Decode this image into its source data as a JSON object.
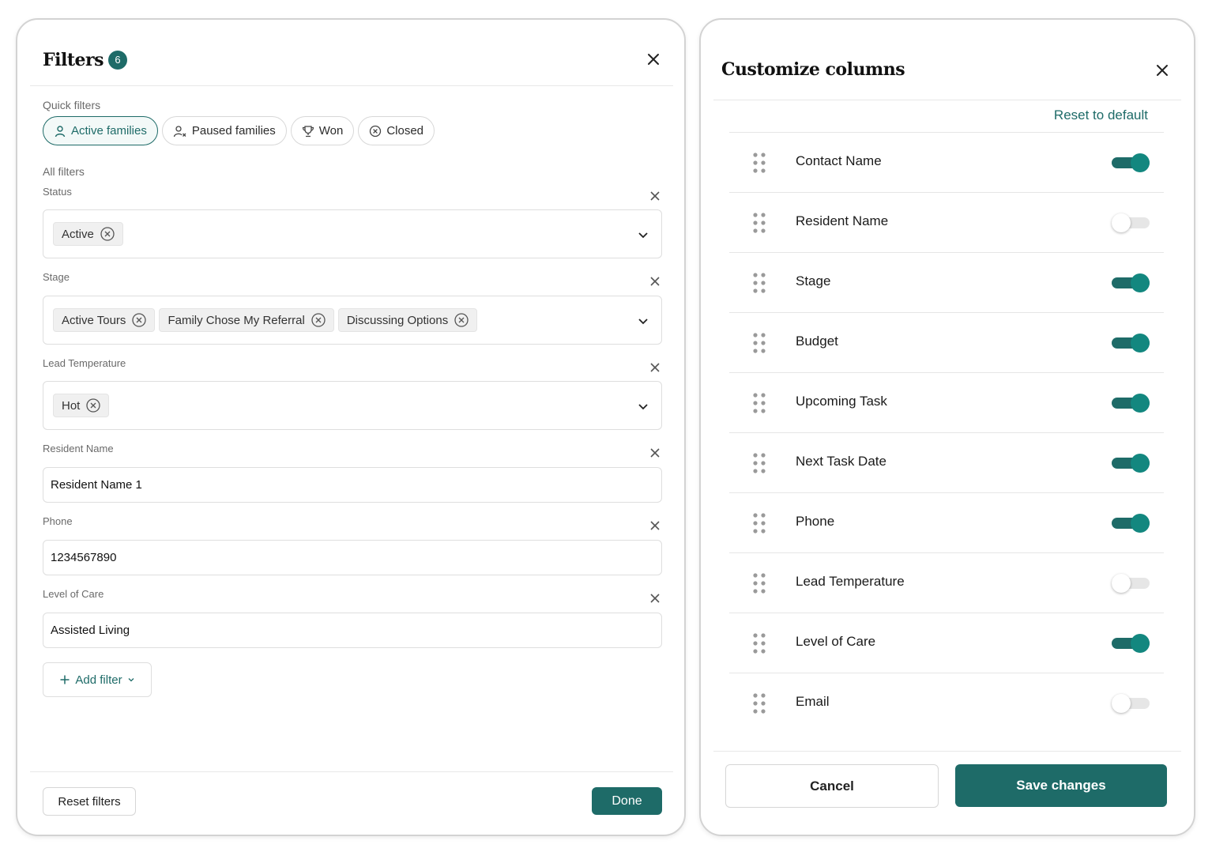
{
  "filters_panel": {
    "title": "Filters",
    "count": "6",
    "quick_filters_label": "Quick filters",
    "quick_filters": [
      {
        "label": "Active families",
        "icon": "user-icon",
        "active": true
      },
      {
        "label": "Paused families",
        "icon": "user-x-icon",
        "active": false
      },
      {
        "label": "Won",
        "icon": "trophy-icon",
        "active": false
      },
      {
        "label": "Closed",
        "icon": "circle-x-icon",
        "active": false
      }
    ],
    "all_filters_label": "All filters",
    "status": {
      "label": "Status",
      "tags": [
        "Active"
      ]
    },
    "stage": {
      "label": "Stage",
      "tags": [
        "Active Tours",
        "Family Chose My Referral",
        "Discussing Options"
      ]
    },
    "lead_temperature": {
      "label": "Lead Temperature",
      "tags": [
        "Hot"
      ]
    },
    "resident_name": {
      "label": "Resident Name",
      "value": "Resident Name 1"
    },
    "phone": {
      "label": "Phone",
      "value": "1234567890"
    },
    "level_of_care": {
      "label": "Level of Care",
      "value": "Assisted Living"
    },
    "add_filter_label": "Add filter",
    "reset_label": "Reset filters",
    "done_label": "Done"
  },
  "columns_panel": {
    "title": "Customize columns",
    "reset_default_label": "Reset to default",
    "columns": [
      {
        "name": "Contact Name",
        "enabled": true
      },
      {
        "name": "Resident Name",
        "enabled": false
      },
      {
        "name": "Stage",
        "enabled": true
      },
      {
        "name": "Budget",
        "enabled": true
      },
      {
        "name": "Upcoming Task",
        "enabled": true
      },
      {
        "name": "Next Task Date",
        "enabled": true
      },
      {
        "name": "Phone",
        "enabled": true
      },
      {
        "name": "Lead Temperature",
        "enabled": false
      },
      {
        "name": "Level of Care",
        "enabled": true
      },
      {
        "name": "Email",
        "enabled": false
      }
    ],
    "cancel_label": "Cancel",
    "save_label": "Save changes"
  },
  "colors": {
    "accent": "#1e6b68",
    "toggle_on": "#13877f"
  }
}
